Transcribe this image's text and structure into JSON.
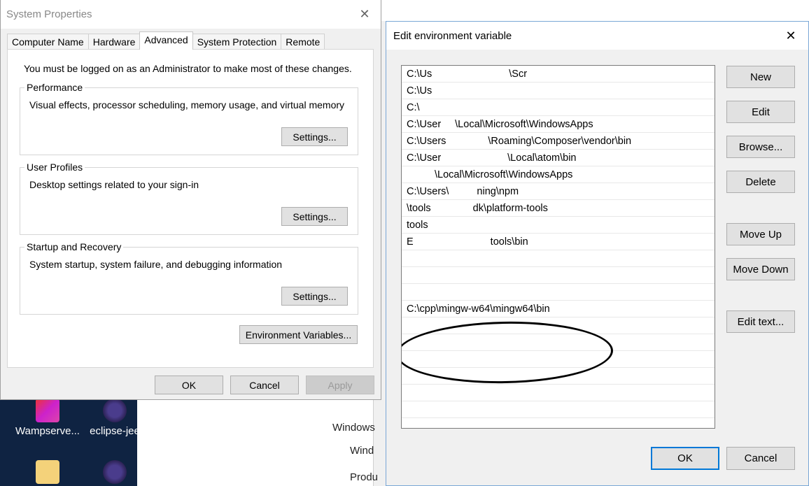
{
  "system_properties": {
    "title": "System Properties",
    "tabs": [
      "Computer Name",
      "Hardware",
      "Advanced",
      "System Protection",
      "Remote"
    ],
    "active_tab": "Advanced",
    "admin_note": "You must be logged on as an Administrator to make most of these changes.",
    "performance": {
      "title": "Performance",
      "desc": "Visual effects, processor scheduling, memory usage, and virtual memory",
      "button": "Settings..."
    },
    "user_profiles": {
      "title": "User Profiles",
      "desc": "Desktop settings related to your sign-in",
      "button": "Settings..."
    },
    "startup": {
      "title": "Startup and Recovery",
      "desc": "System startup, system failure, and debugging information",
      "button": "Settings..."
    },
    "env_vars_button": "Environment Variables...",
    "ok": "OK",
    "cancel": "Cancel",
    "apply": "Apply"
  },
  "edit_env": {
    "title": "Edit environment variable",
    "rows": [
      "C:\\Us",
      "C:\\Us",
      "C:\\",
      "C:\\User",
      "C:\\Users",
      "C:\\User",
      "",
      "C:\\Users\\",
      "\\tools",
      "",
      "E",
      "",
      "",
      "",
      "C:\\cpp\\mingw-w64\\mingw64\\bin",
      "",
      "",
      "",
      "",
      "",
      ""
    ],
    "row_tails": [
      "\\Scr",
      "",
      "",
      "\\Local\\Microsoft\\WindowsApps",
      "\\Roaming\\Composer\\vendor\\bin",
      "\\Local\\atom\\bin",
      "\\Local\\Microsoft\\WindowsApps",
      "ning\\npm",
      "dk\\platform-tools",
      "tools",
      "tools\\bin",
      "",
      "",
      "",
      "",
      "",
      "",
      "",
      "",
      "",
      ""
    ],
    "buttons": {
      "new": "New",
      "edit": "Edit",
      "browse": "Browse...",
      "delete": "Delete",
      "move_up": "Move Up",
      "move_down": "Move Down",
      "edit_text": "Edit text...",
      "ok": "OK",
      "cancel": "Cancel"
    }
  },
  "desktop": {
    "icons": [
      "Wampserve...",
      "eclipse-jee"
    ],
    "background_texts": [
      "Windows",
      "Wind",
      "Produ"
    ]
  }
}
